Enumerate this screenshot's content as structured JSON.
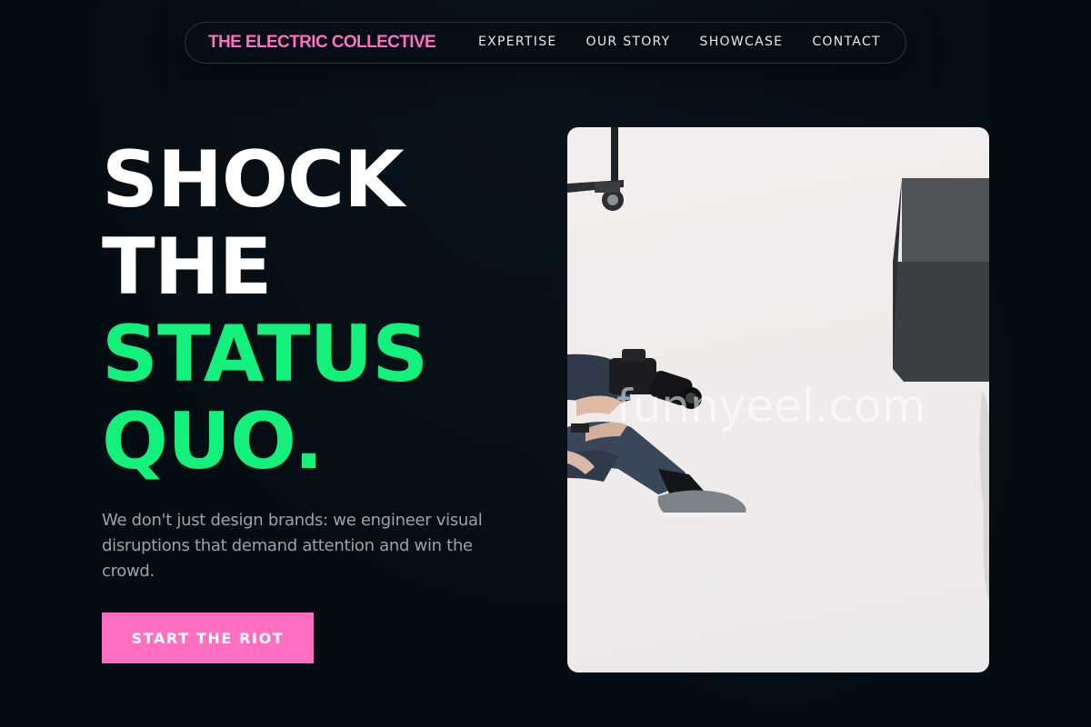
{
  "brand": {
    "name": "THE ELECTRIC COLLECTIVE",
    "color": "#ff6ec0"
  },
  "nav": {
    "items": [
      {
        "label": "EXPERTISE"
      },
      {
        "label": "OUR STORY"
      },
      {
        "label": "SHOWCASE"
      },
      {
        "label": "CONTACT"
      }
    ]
  },
  "hero": {
    "headline": {
      "line1": "SHOCK",
      "line2": "THE",
      "line3": "STATUS",
      "line4": "QUO."
    },
    "description": "We don't just design brands: we engineer visual disruptions that demand attention and win the crowd.",
    "cta_label": "START THE RIOT"
  },
  "image": {
    "subject": "photographer-with-camera-in-white-studio",
    "watermark": "funnyeel.com"
  },
  "colors": {
    "background": "#050d14",
    "accent_green": "#14f07c",
    "accent_pink": "#ff6ec0",
    "text_muted": "#9aa2ad"
  }
}
